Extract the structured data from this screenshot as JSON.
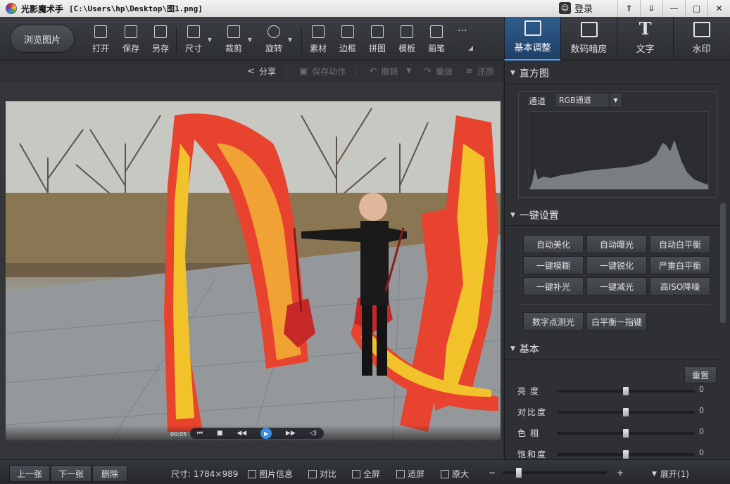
{
  "window": {
    "app_name": "光影魔术手",
    "file_path": "[C:\\Users\\hp\\Desktop\\图1.png]",
    "login_label": "登录",
    "controls": [
      "⇑",
      "⇓",
      "—",
      "□",
      "✕"
    ]
  },
  "toolbar": {
    "browse_label": "浏览图片",
    "tools": [
      {
        "label": "打开",
        "icon": "open-icon"
      },
      {
        "label": "保存",
        "icon": "save-icon"
      },
      {
        "label": "另存",
        "icon": "save-as-icon"
      },
      {
        "label": "尺寸",
        "icon": "resize-icon"
      },
      {
        "label": "裁剪",
        "icon": "crop-icon"
      },
      {
        "label": "旋转",
        "icon": "rotate-icon"
      },
      {
        "label": "素材",
        "icon": "material-icon"
      },
      {
        "label": "边框",
        "icon": "border-icon"
      },
      {
        "label": "拼图",
        "icon": "collage-icon"
      },
      {
        "label": "模板",
        "icon": "template-icon"
      },
      {
        "label": "画笔",
        "icon": "brush-icon"
      }
    ],
    "more": "···",
    "right_tabs": [
      {
        "label": "基本调整",
        "icon": "adjust-icon"
      },
      {
        "label": "数码暗房",
        "icon": "darkroom-icon"
      },
      {
        "label": "文字",
        "icon": "text-icon"
      },
      {
        "label": "水印",
        "icon": "watermark-icon"
      }
    ],
    "text_tab_glyph": "T"
  },
  "actionbar": {
    "share": "分享",
    "save_action": "保存动作",
    "undo": "撤销",
    "redo": "重做",
    "restore": "还原"
  },
  "player": {
    "time": "00:05"
  },
  "panel": {
    "histogram": {
      "title": "直方图",
      "channel_label": "通道",
      "channel_value": "RGB通道"
    },
    "one_click": {
      "title": "一键设置",
      "buttons": [
        "自动美化",
        "自动曝光",
        "自动白平衡",
        "一键模糊",
        "一键锐化",
        "严重白平衡",
        "一键补光",
        "一键减光",
        "高ISO降噪"
      ],
      "extra_buttons": [
        "数字点测光",
        "白平衡一指键"
      ]
    },
    "basic": {
      "title": "基本",
      "reset_label": "重置",
      "sliders": [
        {
          "label": "亮度",
          "value": "0"
        },
        {
          "label": "对比度",
          "value": "0"
        },
        {
          "label": "色相",
          "value": "0"
        },
        {
          "label": "饱和度",
          "value": "0"
        }
      ]
    }
  },
  "bottombar": {
    "prev": "上一张",
    "next": "下一张",
    "delete": "删除",
    "size": "尺寸: 1784×989",
    "info": "图片信息",
    "compare": "对比",
    "fullscreen": "全屏",
    "fit": "适屏",
    "original": "原大",
    "zoom_minus": "−",
    "zoom_plus": "+",
    "expand": "展开(1)"
  },
  "colors": {
    "accent": "#2f5d8c",
    "dragon_red": "#e8432f",
    "dragon_yellow": "#f2c22a"
  }
}
